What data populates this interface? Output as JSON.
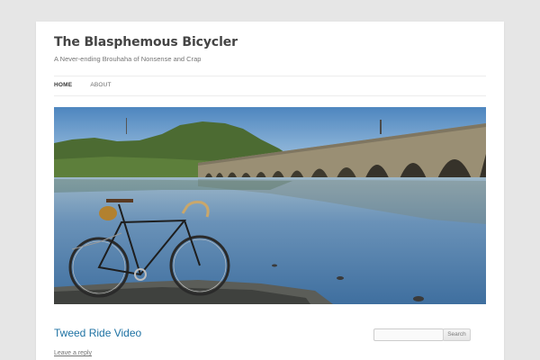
{
  "site": {
    "title": "The Blasphemous Bicycler",
    "description": "A Never-ending Brouhaha of Nonsense and Crap"
  },
  "nav": {
    "items": [
      {
        "label": "HOME",
        "current": true
      },
      {
        "label": "ABOUT",
        "current": false
      }
    ]
  },
  "header_image": {
    "alt": "Bicycle by a river with a stone arch railroad bridge",
    "colors": {
      "sky_top": "#4e86bf",
      "sky_bottom": "#b5d2e8",
      "hill": "#4c6b32",
      "water": "#5e89b4",
      "bridge": "#9a8f74"
    }
  },
  "post": {
    "title": "Tweed Ride Video",
    "reply_label": "Leave a reply"
  },
  "search": {
    "placeholder": "",
    "value": "",
    "button_label": "Search"
  }
}
